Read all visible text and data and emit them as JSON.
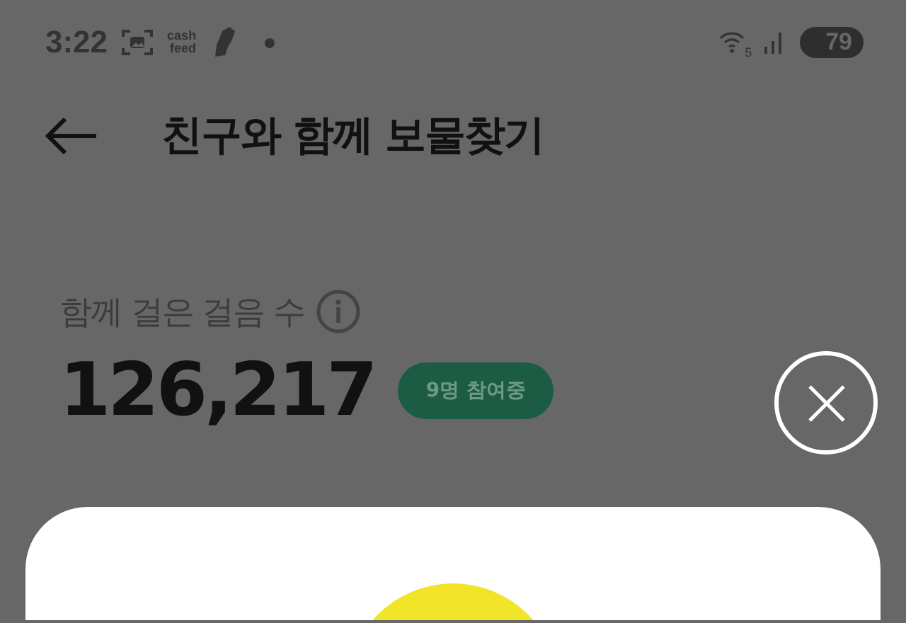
{
  "status_bar": {
    "time": "3:22",
    "app_label": [
      "cash",
      "feed"
    ],
    "network_badge": "5",
    "battery": "79"
  },
  "header": {
    "title": "친구와 함께 보물찾기"
  },
  "steps": {
    "label": "함께 걸은 걸음 수",
    "value": "126,217",
    "participants": "9명 참여중"
  }
}
